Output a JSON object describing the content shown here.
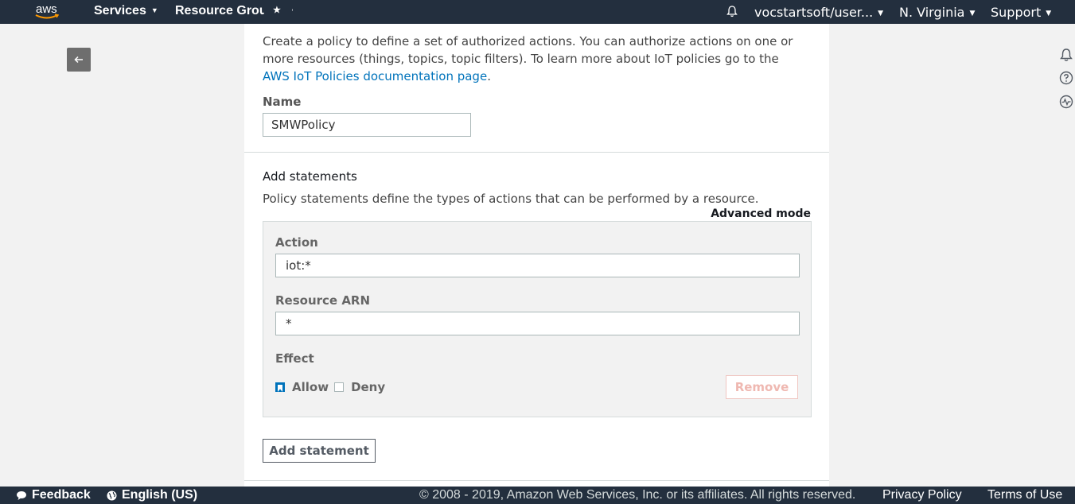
{
  "nav": {
    "logo_text": "aws",
    "services": "Services",
    "resource_groups": "Resource Grou",
    "pin_icon": "star-pin-icon",
    "account": "vocstartsoft/user...",
    "region": "N. Virginia",
    "support": "Support"
  },
  "panel": {
    "intro_text": "Create a policy to define a set of authorized actions. You can authorize actions on one or more resources (things, topics, topic filters). To learn more about IoT policies go to the ",
    "intro_link": "AWS IoT Policies documentation page",
    "intro_end": ".",
    "name_label": "Name",
    "name_value": "SMWPolicy",
    "statements_title": "Add statements",
    "statements_desc": "Policy statements define the types of actions that can be performed by a resource.",
    "advanced_mode": "Advanced mode",
    "statement": {
      "action_label": "Action",
      "action_value": "iot:*",
      "arn_label": "Resource ARN",
      "arn_value": "*",
      "effect_label": "Effect",
      "allow_label": "Allow",
      "allow_checked": true,
      "deny_label": "Deny",
      "deny_checked": false,
      "remove_label": "Remove"
    },
    "add_statement_label": "Add statement"
  },
  "footer": {
    "feedback": "Feedback",
    "language": "English (US)",
    "copyright": "© 2008 - 2019, Amazon Web Services, Inc. or its affiliates. All rights reserved.",
    "privacy": "Privacy Policy",
    "terms": "Terms of Use"
  },
  "colors": {
    "nav_bg": "#232f3e",
    "link": "#0073bb",
    "accent_orange": "#ff9900"
  }
}
